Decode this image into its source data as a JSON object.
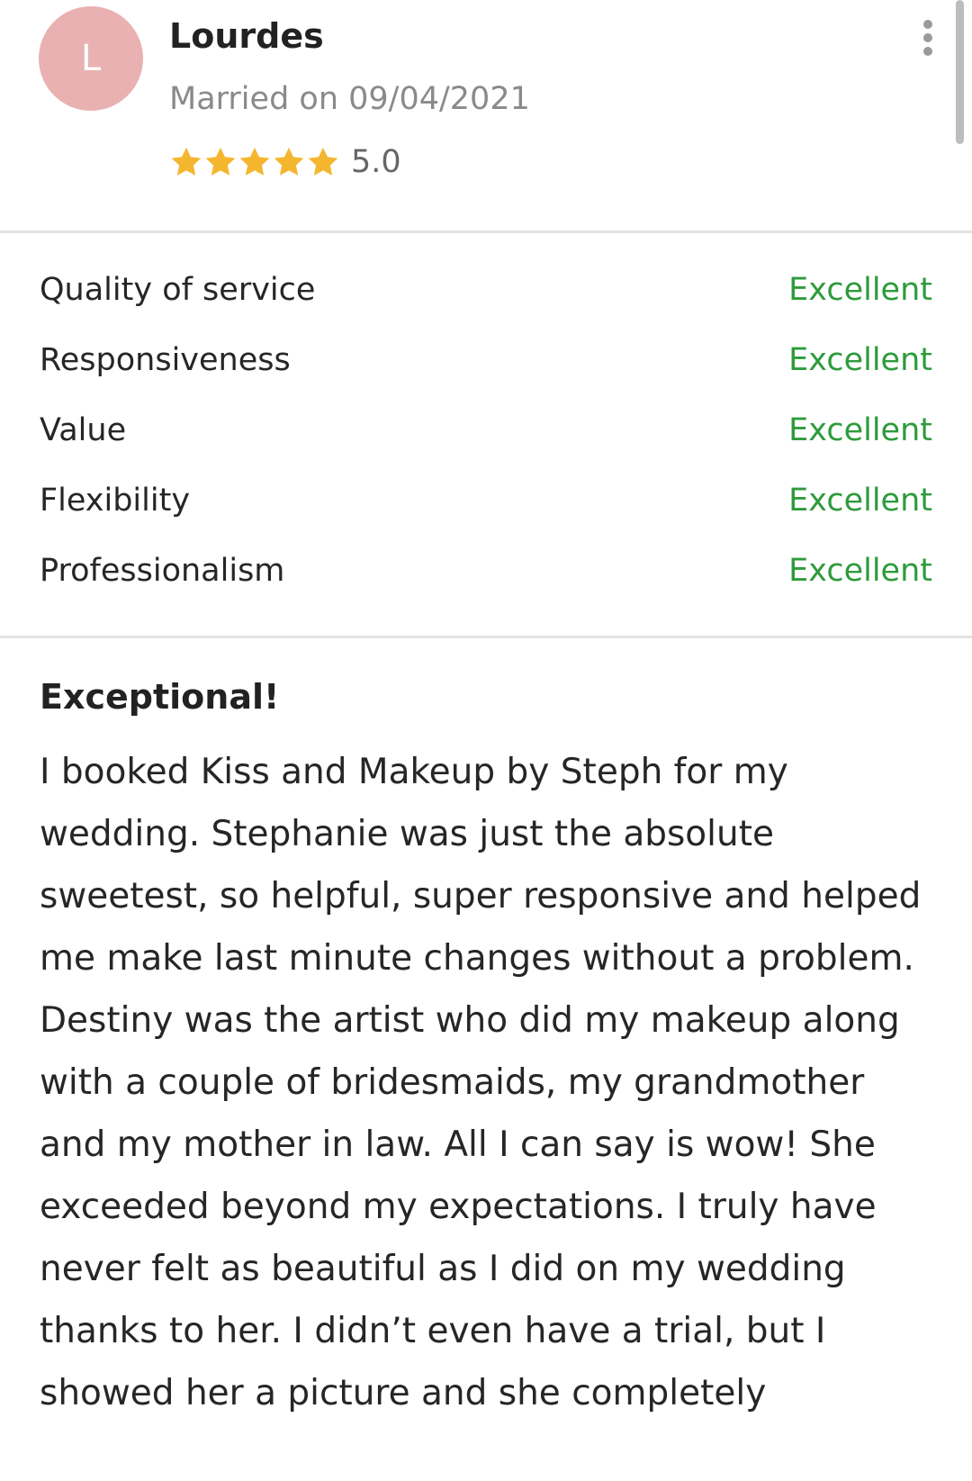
{
  "reviewer": {
    "initial": "L",
    "name": "Lourdes",
    "married": "Married on 09/04/2021",
    "stars": 5,
    "rating": "5.0",
    "avatar_color": "#e9b1b1",
    "star_color": "#f5b62f"
  },
  "ratings": [
    {
      "label": "Quality of service",
      "value": "Excellent"
    },
    {
      "label": "Responsiveness",
      "value": "Excellent"
    },
    {
      "label": "Value",
      "value": "Excellent"
    },
    {
      "label": "Flexibility",
      "value": "Excellent"
    },
    {
      "label": "Professionalism",
      "value": "Excellent"
    }
  ],
  "excellent_color": "#2e9b3c",
  "review": {
    "title": "Exceptional!",
    "body": "I booked Kiss and Makeup by Steph for my wedding. Stephanie was just the absolute sweetest, so helpful, super responsive and helped me make last minute changes without a problem.\nDestiny was the artist who did my makeup along with a couple of bridesmaids, my grandmother and my mother in law. All I can say is wow! She exceeded beyond my expectations. I truly have never felt as beautiful as I did on my wedding thanks to her. I didn’t even have a trial, but I showed her a picture and she completely"
  },
  "icons": {
    "menu": "more-vertical-icon",
    "star": "star-icon"
  }
}
